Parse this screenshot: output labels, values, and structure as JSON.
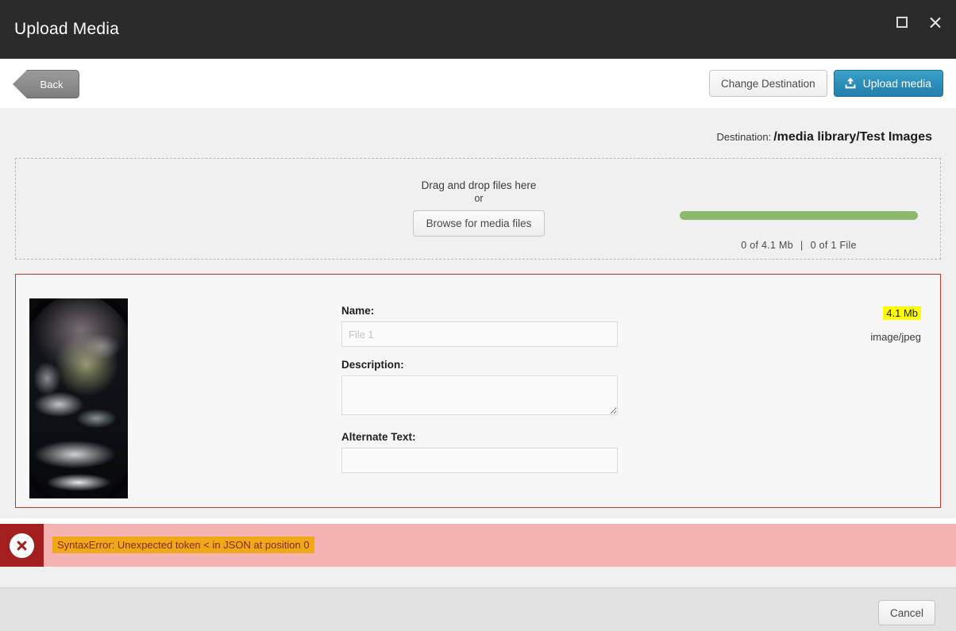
{
  "window": {
    "title": "Upload Media",
    "maximize_icon": "maximize-icon",
    "close_icon": "close-icon"
  },
  "toolbar": {
    "back_label": "Back",
    "change_destination_label": "Change Destination",
    "upload_media_label": "Upload media",
    "upload_icon": "upload-icon"
  },
  "destination": {
    "label": "Destination:",
    "path": "/media library/Test Images"
  },
  "dropzone": {
    "drag_text": "Drag and drop files here",
    "or_text": "or",
    "browse_label": "Browse for media files"
  },
  "progress": {
    "percent": 100,
    "bar_color": "#8cb96c",
    "bytes_text": "0 of 4.1 Mb",
    "separator": "|",
    "files_text": "0 of 1  File"
  },
  "file_card": {
    "border_color": "#c0392b",
    "thumbnail_name": "earth-from-space-thumbnail",
    "fields": {
      "name_label": "Name:",
      "name_value": "",
      "name_placeholder": "File 1",
      "description_label": "Description:",
      "description_value": "",
      "description_placeholder": "",
      "alternate_text_label": "Alternate Text:",
      "alternate_text_value": "",
      "alternate_text_placeholder": ""
    },
    "meta": {
      "size": "4.1 Mb",
      "size_highlight_color": "#ffff00",
      "mime_type": "image/jpeg"
    }
  },
  "error": {
    "dismiss_icon": "close-error-icon",
    "message": "SyntaxError: Unexpected token < in JSON at position 0",
    "highlight_color": "#f0a818",
    "bar_color": "#f4b2b0",
    "icon_box_color": "#a31f1f"
  },
  "footer": {
    "cancel_label": "Cancel"
  }
}
